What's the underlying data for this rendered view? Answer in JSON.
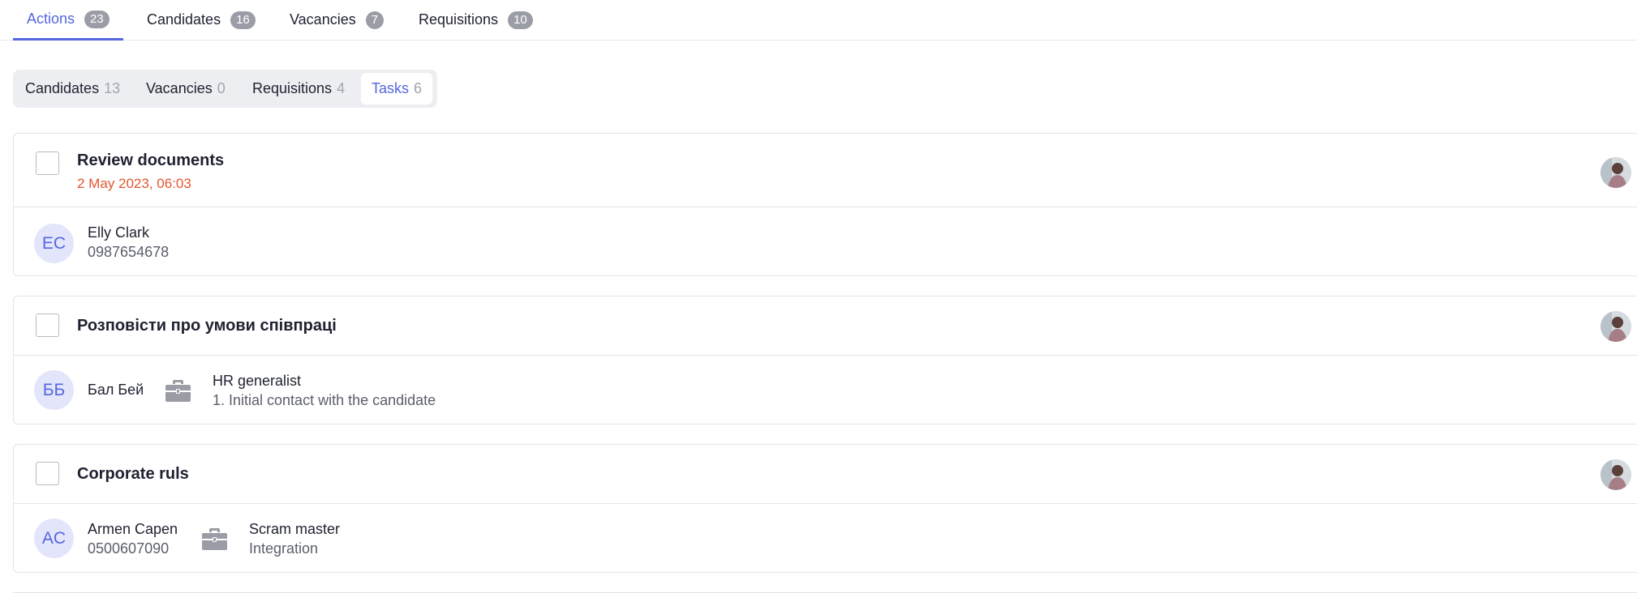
{
  "top_tabs": [
    {
      "label": "Actions",
      "count": "23",
      "active": true
    },
    {
      "label": "Candidates",
      "count": "16",
      "active": false
    },
    {
      "label": "Vacancies",
      "count": "7",
      "active": false
    },
    {
      "label": "Requisitions",
      "count": "10",
      "active": false
    }
  ],
  "sub_tabs": [
    {
      "label": "Candidates",
      "count": "13",
      "active": false
    },
    {
      "label": "Vacancies",
      "count": "0",
      "active": false
    },
    {
      "label": "Requisitions",
      "count": "4",
      "active": false
    },
    {
      "label": "Tasks",
      "count": "6",
      "active": true
    }
  ],
  "tasks": [
    {
      "title": "Review documents",
      "due": "2 May 2023, 06:03",
      "contact": {
        "initials": "EC",
        "name": "Elly Clark",
        "phone": "0987654678"
      }
    },
    {
      "title": "Розповісти про умови співпраці",
      "contact": {
        "initials": "ББ",
        "name": "Бал Бей"
      },
      "vacancy": {
        "title": "HR generalist",
        "stage": "1. Initial contact with the candidate"
      }
    },
    {
      "title": "Corporate ruls",
      "contact": {
        "initials": "AC",
        "name": "Armen Capen",
        "phone": "0500607090"
      },
      "vacancy": {
        "title": "Scram master",
        "stage": "Integration"
      }
    }
  ],
  "colors": {
    "accent": "#5566e0",
    "due_date": "#e2562f",
    "badge": "#9b9da6"
  },
  "icons": {
    "vacancy": "briefcase-icon",
    "owner": "user-avatar"
  }
}
